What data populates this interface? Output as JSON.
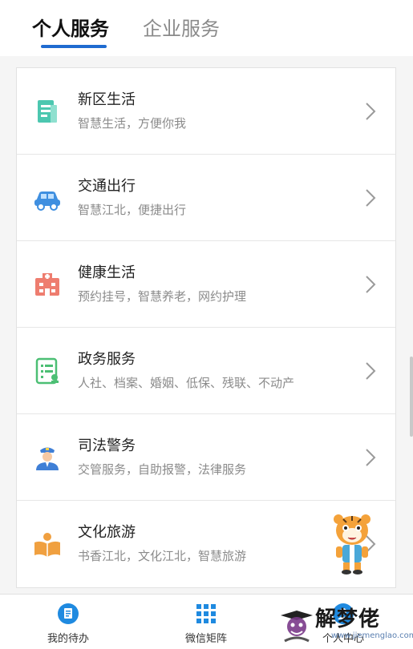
{
  "tabs": {
    "personal": "个人服务",
    "enterprise": "企业服务"
  },
  "services": [
    {
      "title": "新区生活",
      "subtitle": "智慧生活，方便你我",
      "icon": "document-icon",
      "color": "#4cc7b0"
    },
    {
      "title": "交通出行",
      "subtitle": "智慧江北，便捷出行",
      "icon": "car-icon",
      "color": "#3f8fe0"
    },
    {
      "title": "健康生活",
      "subtitle": "预约挂号，智慧养老，网约护理",
      "icon": "hospital-icon",
      "color": "#ee7d6f"
    },
    {
      "title": "政务服务",
      "subtitle": "人社、档案、婚姻、低保、残联、不动产",
      "icon": "form-icon",
      "color": "#4cbf74"
    },
    {
      "title": "司法警务",
      "subtitle": "交管服务，自助报警，法律服务",
      "icon": "police-icon",
      "color": "#3f7fd6"
    },
    {
      "title": "文化旅游",
      "subtitle": "书香江北，文化江北，智慧旅游",
      "icon": "book-icon",
      "color": "#f0a040"
    }
  ],
  "bottom_nav": {
    "todo": "我的待办",
    "matrix": "微信矩阵",
    "center": "个人中心"
  },
  "watermark": {
    "text": "解梦佬",
    "url": "www.jiemenglao.com"
  },
  "colors": {
    "accent": "#1f6bd0"
  }
}
